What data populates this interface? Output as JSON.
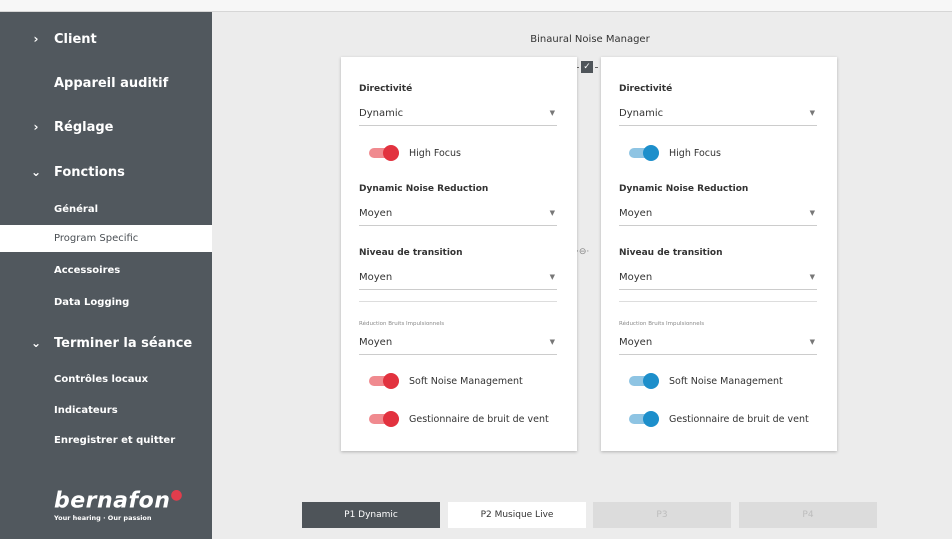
{
  "sidebar": {
    "items": [
      {
        "label": "Client",
        "chevron": "›"
      },
      {
        "label": "Appareil auditif"
      },
      {
        "label": "Réglage",
        "chevron": "›"
      },
      {
        "label": "Fonctions",
        "chevron": "⌄"
      },
      {
        "label": "Général"
      },
      {
        "label": "Program Specific"
      },
      {
        "label": "Accessoires"
      },
      {
        "label": "Data Logging"
      },
      {
        "label": "Terminer la séance",
        "chevron": "⌄"
      },
      {
        "label": "Contrôles locaux"
      },
      {
        "label": "Indicateurs"
      },
      {
        "label": "Enregistrer et quitter"
      }
    ],
    "brand": {
      "name": "bernafon",
      "tagline": "Your hearing · Our passion"
    }
  },
  "main": {
    "title": "Binaural Noise Manager"
  },
  "left_panel": {
    "directivity_label": "Directivité",
    "directivity_value": "Dynamic",
    "high_focus_label": "High Focus",
    "dnr_label": "Dynamic Noise Reduction",
    "dnr_value": "Moyen",
    "transition_label": "Niveau de transition",
    "transition_value": "Moyen",
    "impulse_label": "Réduction Bruits Impulsionnels",
    "impulse_value": "Moyen",
    "soft_noise_label": "Soft Noise Management",
    "wind_label": "Gestionnaire de bruit de vent"
  },
  "right_panel": {
    "directivity_label": "Directivité",
    "directivity_value": "Dynamic",
    "high_focus_label": "High Focus",
    "dnr_label": "Dynamic Noise Reduction",
    "dnr_value": "Moyen",
    "transition_label": "Niveau de transition",
    "transition_value": "Moyen",
    "impulse_label": "Réduction Bruits Impulsionnels",
    "impulse_value": "Moyen",
    "soft_noise_label": "Soft Noise Management",
    "wind_label": "Gestionnaire de bruit de vent"
  },
  "link": {
    "check": "✓",
    "chain": "·⊖·"
  },
  "program_tabs": [
    {
      "label": "P1 Dynamic"
    },
    {
      "label": "P2 Musique Live"
    },
    {
      "label": "P3"
    },
    {
      "label": "P4"
    }
  ],
  "colors": {
    "sidebar": "#51585e",
    "left_accent": "#e2323f",
    "right_accent": "#1d8fcb"
  }
}
